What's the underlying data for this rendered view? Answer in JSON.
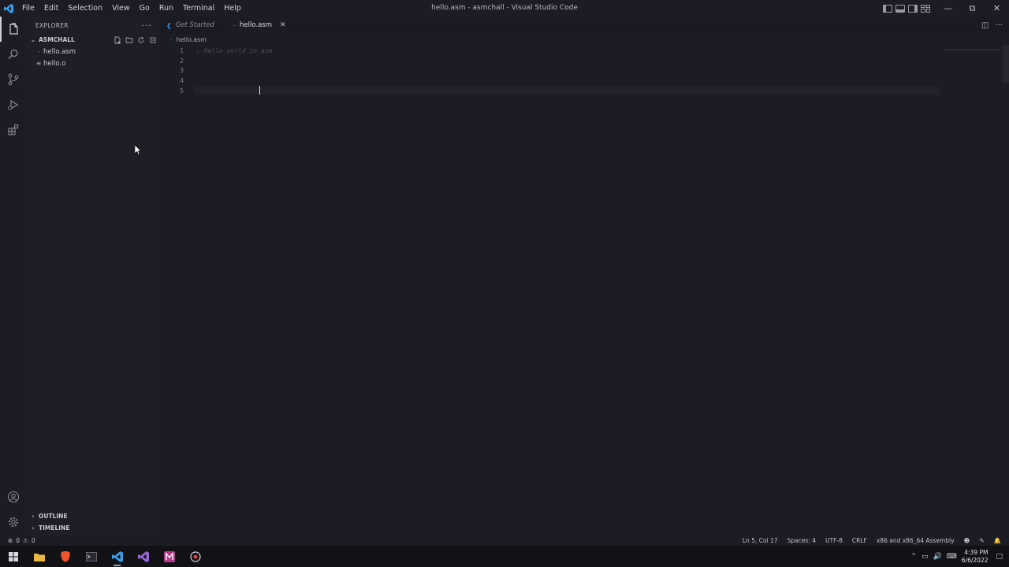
{
  "window": {
    "title": "hello.asm - asmchall - Visual Studio Code",
    "menu": [
      "File",
      "Edit",
      "Selection",
      "View",
      "Go",
      "Run",
      "Terminal",
      "Help"
    ]
  },
  "sidebar": {
    "title": "EXPLORER",
    "folder": "ASMCHALL",
    "files": [
      {
        "name": "hello.asm",
        "icon": "asm-file-icon"
      },
      {
        "name": "hello.o",
        "icon": "generic-file-icon"
      }
    ],
    "outline_label": "OUTLINE",
    "timeline_label": "TIMELINE"
  },
  "tabs": [
    {
      "label": "Get Started",
      "active": false
    },
    {
      "label": "hello.asm",
      "active": true
    }
  ],
  "breadcrumb": "hello.asm",
  "editor": {
    "lines": [
      {
        "num": "1",
        "text": "; Hello world in asm"
      },
      {
        "num": "2",
        "text": ""
      },
      {
        "num": "3",
        "text": ""
      },
      {
        "num": "4",
        "text": ""
      },
      {
        "num": "5",
        "text": ""
      }
    ]
  },
  "status": {
    "errors": "0",
    "warnings": "0",
    "position": "Ln 5, Col 17",
    "spaces": "Spaces: 4",
    "encoding": "UTF-8",
    "eol": "CRLF",
    "language": "x86 and x86_64 Assembly"
  },
  "taskbar": {
    "time": "4:39 PM",
    "date": "6/6/2022"
  },
  "colors": {
    "background": "#1c1c24",
    "accent_asm": "#d04060",
    "vscode_blue": "#3c9ee8"
  }
}
